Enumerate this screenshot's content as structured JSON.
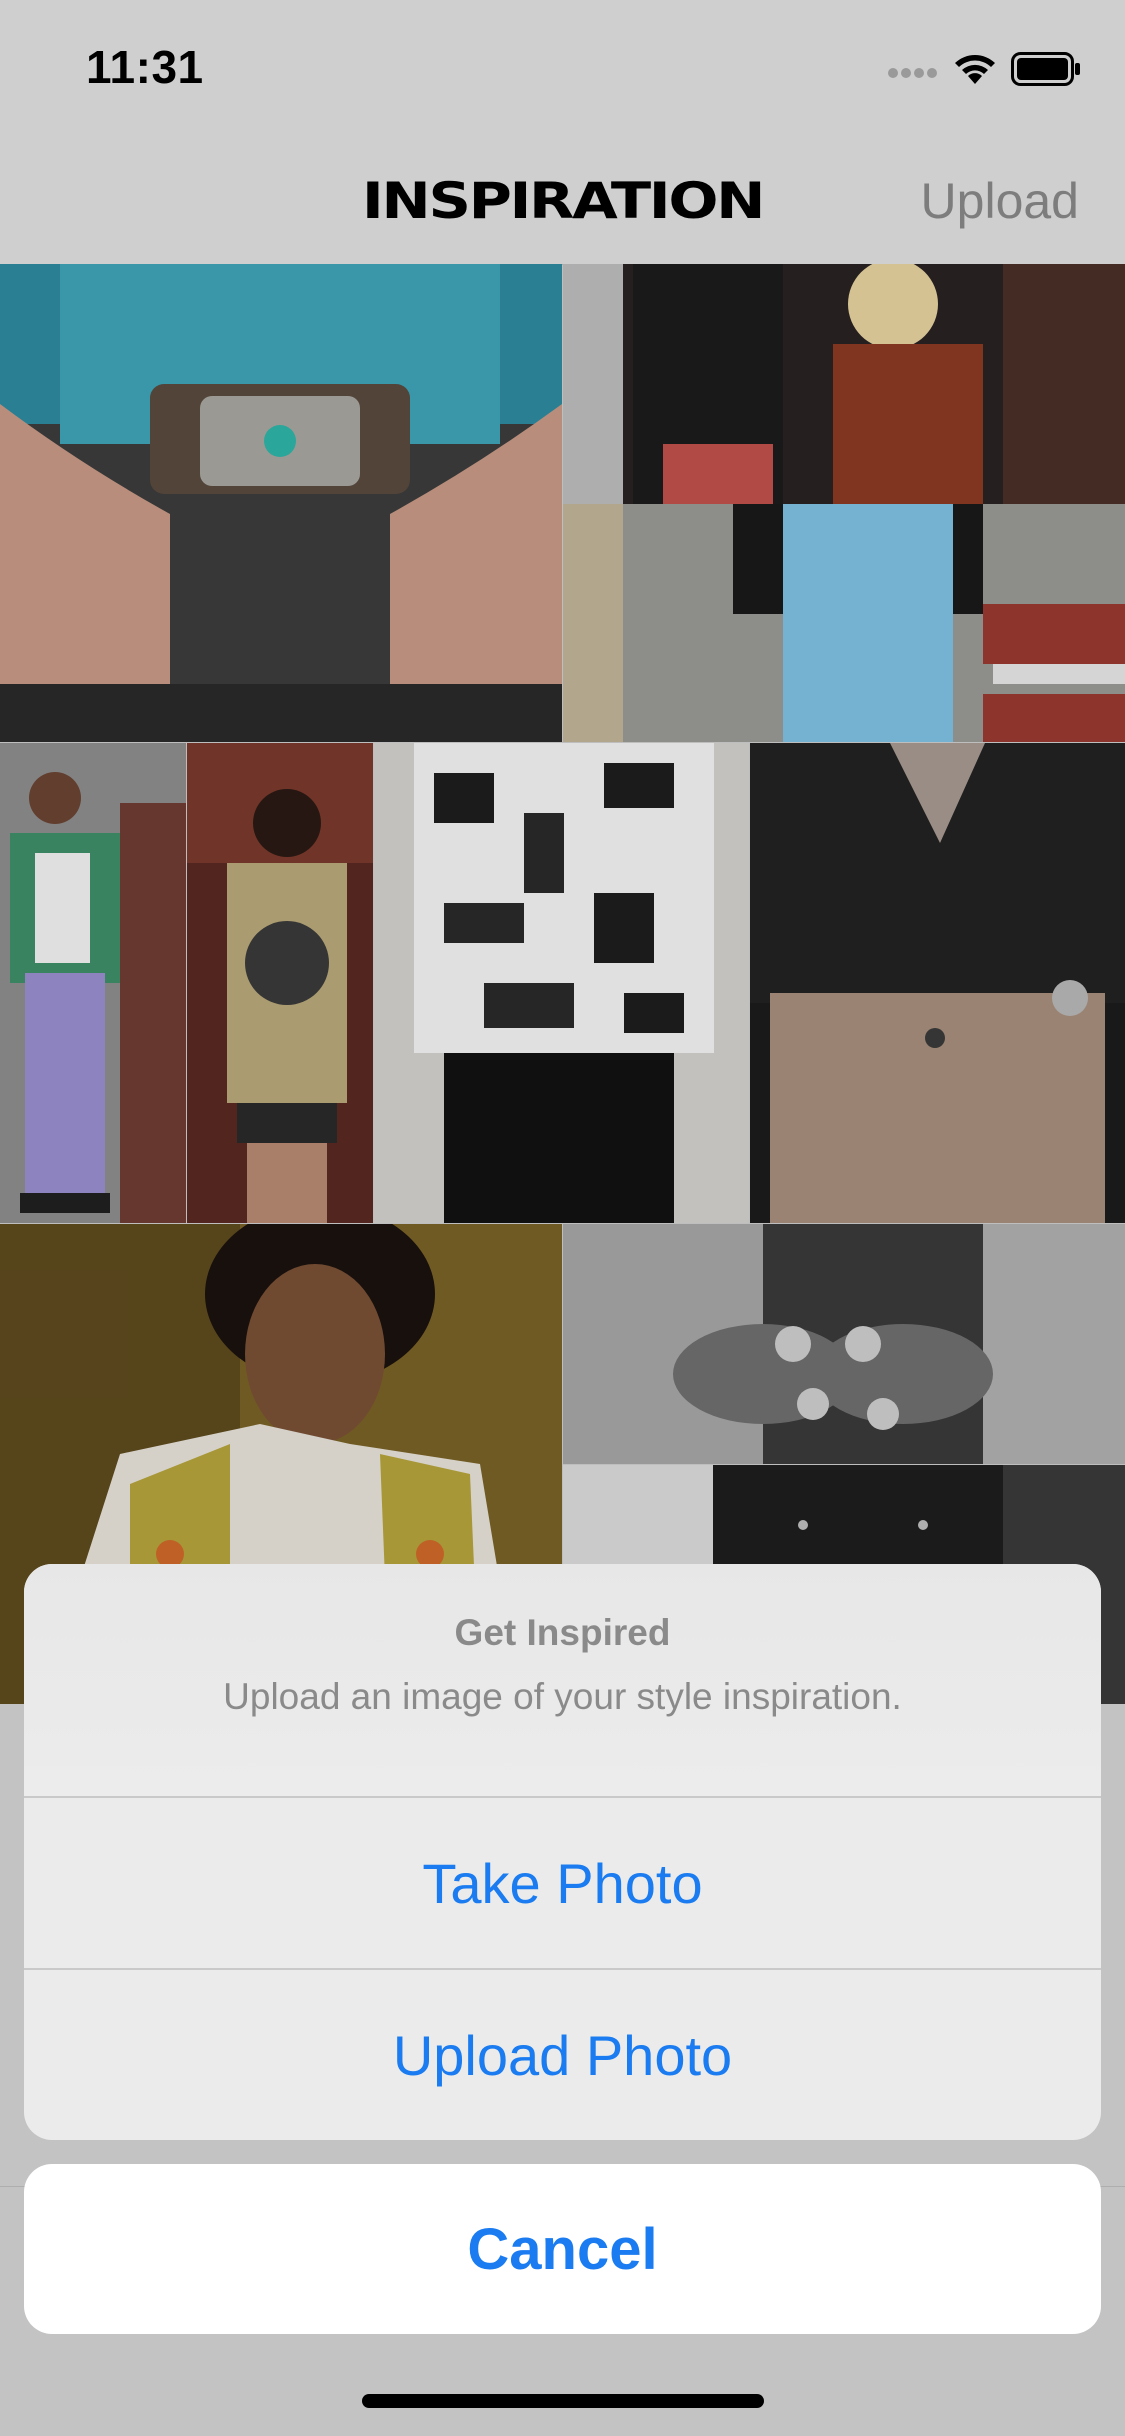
{
  "status_bar": {
    "time": "11:31",
    "icons": [
      "cellular-signal-icon",
      "wifi-icon",
      "battery-icon"
    ]
  },
  "nav": {
    "title": "INSPIRATION",
    "upload_label": "Upload"
  },
  "grid": {
    "photos": [
      {
        "name": "photo-turquoise-belt-buckle",
        "description_icon": "photo-icon"
      },
      {
        "name": "photo-group-party",
        "description_icon": "photo-icon"
      },
      {
        "name": "photo-blue-trousers",
        "description_icon": "photo-icon"
      },
      {
        "name": "photo-floral-shirt-street",
        "description_icon": "photo-icon"
      },
      {
        "name": "photo-graphic-tee",
        "description_icon": "photo-icon"
      },
      {
        "name": "photo-abstract-print-shirt",
        "description_icon": "photo-icon"
      },
      {
        "name": "photo-leather-shirt-tan-pants",
        "description_icon": "photo-icon"
      },
      {
        "name": "photo-embroidered-vest-portrait",
        "description_icon": "photo-icon"
      },
      {
        "name": "photo-skull-rings-bw",
        "description_icon": "photo-icon"
      },
      {
        "name": "photo-leather-jacket-bw",
        "description_icon": "photo-icon"
      }
    ]
  },
  "action_sheet": {
    "title": "Get Inspired",
    "message": "Upload an image of your style inspiration.",
    "take_photo_label": "Take Photo",
    "upload_photo_label": "Upload Photo",
    "cancel_label": "Cancel"
  },
  "colors": {
    "accent": "#1a7cf0",
    "muted_text": "#8a8a8a"
  }
}
